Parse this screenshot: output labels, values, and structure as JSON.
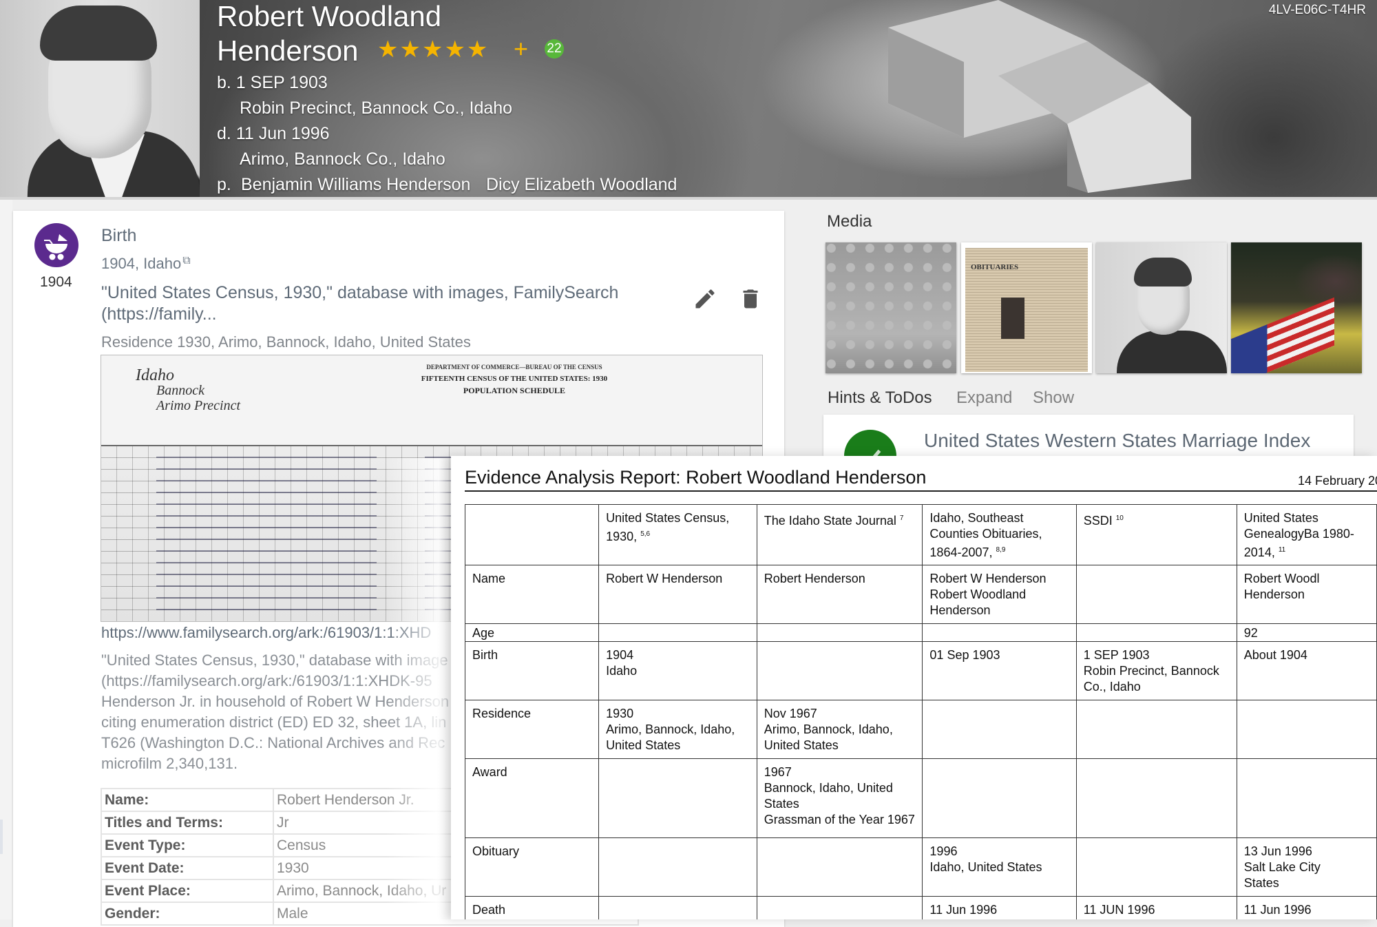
{
  "header": {
    "name_line1": "Robert Woodland",
    "name_line2": "Henderson",
    "stars": "★★★★★",
    "star_rating": 5,
    "plus_label": "+",
    "badge_count": "22",
    "birth": "b. 1 SEP 1903",
    "birth_place": "Robin Precinct, Bannock Co., Idaho",
    "death": "d. 11 Jun 1996",
    "death_place": "Arimo, Bannock Co., Idaho",
    "parents_prefix": "p.",
    "father": "Benjamin Williams Henderson",
    "mother": "Dicy Elizabeth Woodland",
    "person_id": "4LV-E06C-T4HR"
  },
  "event": {
    "icon": "baby-carriage-icon",
    "year": "1904",
    "title": "Birth",
    "date_place": "1904,  Idaho",
    "source_line1": "\"United States Census, 1930,\" database with images, FamilySearch",
    "source_line2": "(https://family...",
    "residence": "Residence 1930, Arimo, Bannock, Idaho, United States",
    "census_image": {
      "state": "Idaho",
      "county": "Bannock",
      "township": "Arimo Precinct",
      "form_title": "DEPARTMENT OF COMMERCE—BUREAU OF THE CENSUS",
      "census_title": "FIFTEENTH CENSUS OF THE UNITED STATES: 1930",
      "schedule_title": "POPULATION SCHEDULE"
    },
    "ark_link": "https://www.familysearch.org/ark:/61903/1:1:XHD",
    "citation_lines": [
      "\"United States Census, 1930,\" database with image",
      "(https://familysearch.org/ark:/61903/1:1:XHDK-95",
      "Henderson Jr. in household of Robert W Henderson",
      "citing enumeration district (ED) ED 32, sheet 1A, lin",
      "T626 (Washington D.C.: National Archives and Rec",
      "microfilm 2,340,131."
    ],
    "facts": [
      {
        "label": "Name:",
        "value": "Robert Henderson Jr."
      },
      {
        "label": "Titles and Terms:",
        "value": "Jr"
      },
      {
        "label": "Event Type:",
        "value": "Census"
      },
      {
        "label": "Event Date:",
        "value": "1930"
      },
      {
        "label": "Event Place:",
        "value": "Arimo, Bannock, Idaho, Ur"
      },
      {
        "label": "Gender:",
        "value": "Male"
      }
    ]
  },
  "media": {
    "title": "Media",
    "items": [
      {
        "name": "family-group-photo"
      },
      {
        "name": "obituary-clipping",
        "heading": "OBITUARIES"
      },
      {
        "name": "portrait-photo"
      },
      {
        "name": "funeral-flag-photo"
      }
    ]
  },
  "hints": {
    "title": "Hints & ToDos",
    "expand_label": "Expand",
    "show_label": "Show",
    "item_text": "United States Western States Marriage Index",
    "item_icon": "check-circle-icon"
  },
  "report": {
    "title": "Evidence Analysis Report: Robert Woodland Henderson",
    "date": "14 February 20",
    "columns": [
      {
        "label": "",
        "sup": ""
      },
      {
        "label": "United States Census, 1930,",
        "sup": "5,6"
      },
      {
        "label": "The Idaho State Journal",
        "sup": "7"
      },
      {
        "label": "Idaho, Southeast Counties Obituaries, 1864-2007,",
        "sup": "8,9"
      },
      {
        "label": "SSDI",
        "sup": "10"
      },
      {
        "label": "United States GenealogyBa 1980-2014,",
        "sup": "11"
      }
    ],
    "rows": [
      {
        "label": "Name",
        "cells": [
          [
            "Robert W Henderson"
          ],
          [
            "Robert Henderson"
          ],
          [
            "Robert W Henderson",
            "Robert Woodland",
            "Henderson"
          ],
          [],
          [
            "Robert Woodl",
            "Henderson"
          ]
        ]
      },
      {
        "label": "Age",
        "cells": [
          [],
          [],
          [],
          [],
          [
            "92"
          ]
        ]
      },
      {
        "label": "Birth",
        "cells": [
          [
            "1904",
            "Idaho"
          ],
          [],
          [
            "01 Sep 1903"
          ],
          [
            "1 SEP 1903",
            "Robin Precinct, Bannock",
            "Co., Idaho"
          ],
          [
            "About 1904"
          ]
        ]
      },
      {
        "label": "Residence",
        "cells": [
          [
            "1930",
            "Arimo, Bannock, Idaho,",
            "United States"
          ],
          [
            "Nov 1967",
            "Arimo, Bannock, Idaho,",
            "United States"
          ],
          [],
          [],
          []
        ]
      },
      {
        "label": "Award",
        "cells": [
          [],
          [
            "1967",
            "Bannock, Idaho, United",
            "States",
            "Grassman of the Year 1967"
          ],
          [],
          [],
          []
        ]
      },
      {
        "label": "Obituary",
        "cells": [
          [],
          [],
          [
            "1996",
            "Idaho, United States"
          ],
          [],
          [
            "13 Jun 1996",
            "Salt Lake City",
            "States"
          ]
        ]
      },
      {
        "label": "Death",
        "cells": [
          [],
          [],
          [
            "11 Jun 1996"
          ],
          [
            "11 JUN 1996"
          ],
          [
            "11 Jun 1996"
          ]
        ]
      }
    ]
  },
  "colors": {
    "event_purple": "#5b2a8e",
    "star_gold": "#f5b400",
    "badge_green": "#58b83a",
    "hint_green": "#1a7d1a"
  }
}
